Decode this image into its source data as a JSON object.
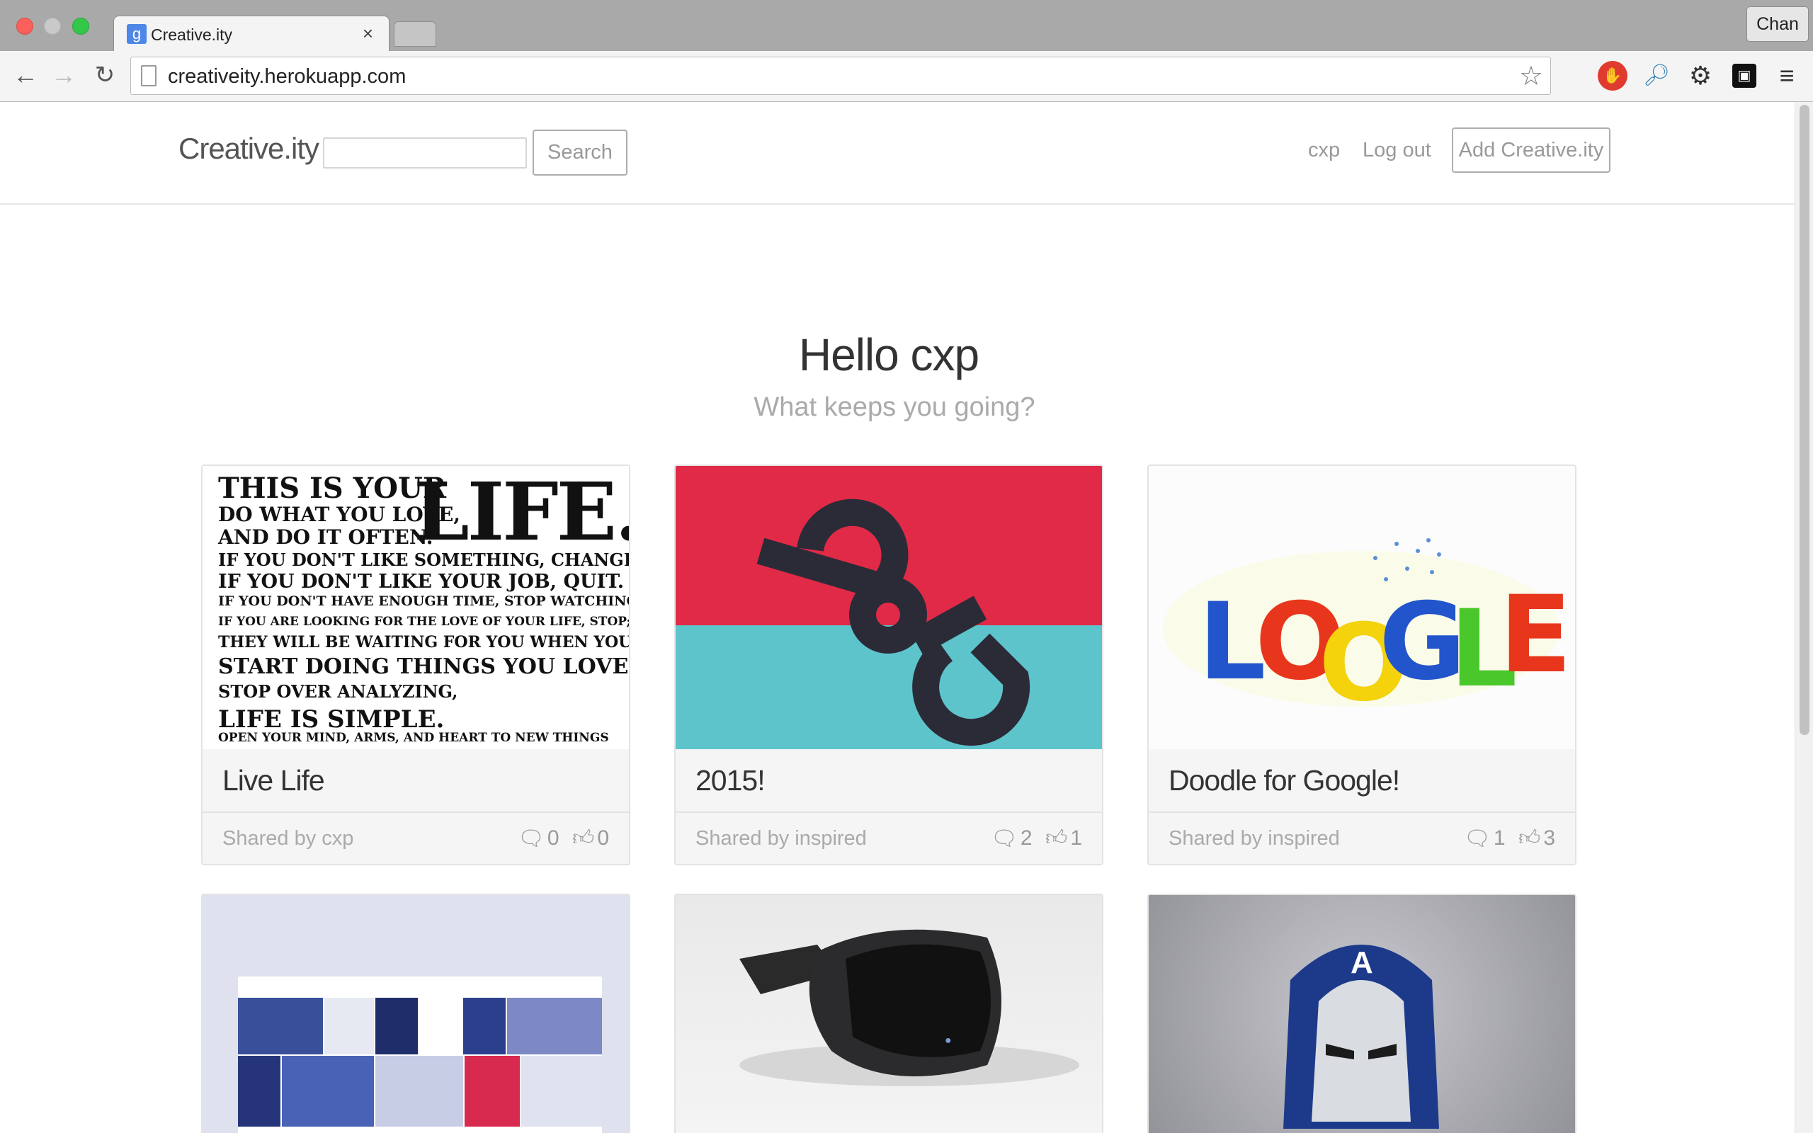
{
  "browser": {
    "tab_title": "Creative.ity",
    "tab_close": "×",
    "favicon_letter": "g",
    "profile_name": "Chan",
    "url": "creativeity.herokuapp.com",
    "icons": {
      "back": "arrow-left-icon",
      "forward": "arrow-right-icon",
      "reload": "reload-icon",
      "bookmark": "star-icon",
      "adblock": "adblock-icon",
      "extension": "magnifier-icon",
      "settings": "gear-icon",
      "extension_box": "box-icon",
      "menu": "hamburger-icon"
    }
  },
  "site": {
    "brand": "Creative.ity",
    "search_placeholder": "",
    "search_button": "Search",
    "nav": {
      "username": "cxp",
      "logout": "Log out",
      "add": "Add Creative.ity"
    }
  },
  "hero": {
    "title": "Hello cxp",
    "subtitle": "What keeps you going?"
  },
  "cards": [
    {
      "title": "Live Life",
      "shared_by": "Shared by cxp",
      "comments": "0",
      "likes": "0"
    },
    {
      "title": "2015!",
      "shared_by": "Shared by inspired",
      "comments": "2",
      "likes": "1"
    },
    {
      "title": "Doodle for Google!",
      "shared_by": "Shared by inspired",
      "comments": "1",
      "likes": "3"
    }
  ],
  "poster": {
    "big": "LIFE.",
    "lines": [
      "THIS IS YOUR",
      "DO WHAT YOU LOVE,",
      "AND DO IT OFTEN.",
      "IF YOU DON'T LIKE SOMETHING, CHANGE IT.",
      "IF YOU DON'T LIKE YOUR JOB, QUIT.",
      "IF YOU DON'T HAVE ENOUGH TIME, STOP WATCHING TV.",
      "IF YOU ARE LOOKING FOR THE LOVE OF YOUR LIFE, STOP;",
      "THEY WILL BE WAITING FOR YOU WHEN YOU",
      "START DOING THINGS YOU LOVE.",
      "STOP OVER ANALYZING,",
      "LIFE IS SIMPLE.",
      "OPEN YOUR MIND, ARMS, AND HEART TO NEW THINGS"
    ]
  },
  "doodle_letters": [
    "L",
    "O",
    "O",
    "G",
    "L",
    "E"
  ],
  "colors": {
    "accent_red": "#e12a47",
    "accent_teal": "#5ec4cb",
    "muted_text": "#999999"
  }
}
